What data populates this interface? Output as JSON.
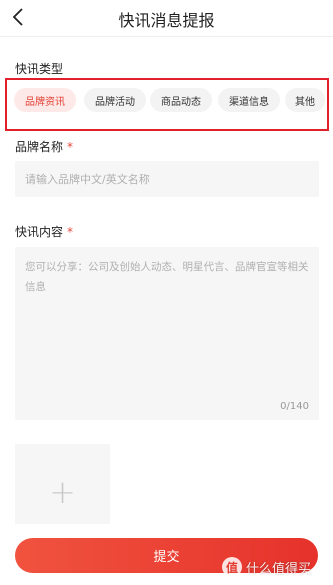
{
  "header": {
    "title": "快讯消息提报",
    "back_icon": "chevron-left-icon"
  },
  "type_section": {
    "label": "快讯类型",
    "chips": [
      {
        "label": "品牌资讯",
        "selected": true
      },
      {
        "label": "品牌活动",
        "selected": false
      },
      {
        "label": "商品动态",
        "selected": false
      },
      {
        "label": "渠道信息",
        "selected": false
      },
      {
        "label": "其他",
        "selected": false
      }
    ],
    "highlight_color": "#e0202a"
  },
  "brand_section": {
    "label": "品牌名称",
    "required_mark": "*",
    "placeholder": "请输入品牌中文/英文名称",
    "value": ""
  },
  "content_section": {
    "label": "快讯内容",
    "required_mark": "*",
    "placeholder": "您可以分享：公司及创始人动态、明星代言、品牌官宣等相关信息",
    "value": "",
    "counter": "0/140"
  },
  "upload": {
    "icon": "plus-icon",
    "symbol": "+"
  },
  "submit": {
    "label": "提交",
    "accent": "#e6322b"
  },
  "watermark": {
    "logo_char": "值",
    "text": "什么值得买"
  }
}
